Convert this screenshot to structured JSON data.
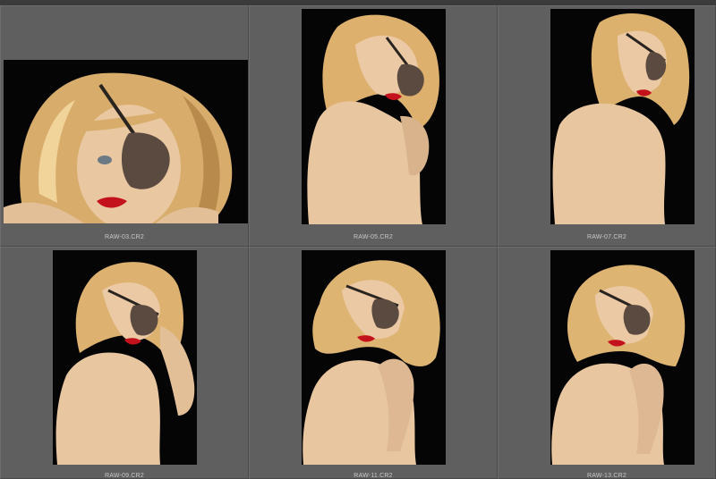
{
  "grid": {
    "cells": [
      {
        "filename": "RAW-03.CR2",
        "orientation": "landscape",
        "pose": "eyepatch-closeup"
      },
      {
        "filename": "RAW-05.CR2",
        "orientation": "portrait",
        "pose": "back-turned"
      },
      {
        "filename": "RAW-07.CR2",
        "orientation": "portrait",
        "pose": "back-turned"
      },
      {
        "filename": "RAW-09.CR2",
        "orientation": "portrait",
        "pose": "hand-in-hair"
      },
      {
        "filename": "RAW-11.CR2",
        "orientation": "portrait",
        "pose": "hand-on-shoulder"
      },
      {
        "filename": "RAW-13.CR2",
        "orientation": "portrait",
        "pose": "hand-on-shoulder"
      }
    ]
  },
  "colors": {
    "background": "#5e5e5e",
    "photo_background": "#050505",
    "hair": "#e0b878",
    "skin": "#e9c9a6",
    "eyepatch": "#5a4a40",
    "lips": "#c4121c"
  }
}
